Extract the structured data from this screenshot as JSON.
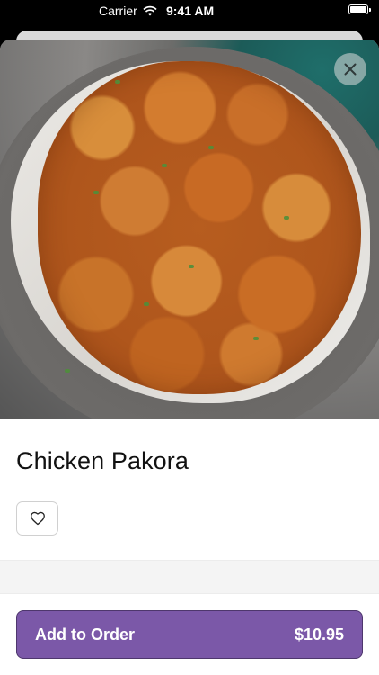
{
  "status_bar": {
    "carrier": "Carrier",
    "time": "9:41 AM"
  },
  "item": {
    "name": "Chicken Pakora",
    "image_icon": "chicken-pakora-photo"
  },
  "actions": {
    "close_icon": "close-icon",
    "favorite_icon": "heart-icon",
    "add_to_order_label": "Add to Order",
    "price": "$10.95"
  },
  "colors": {
    "accent": "#7b58a8",
    "accent_border": "#4e376d",
    "text": "#111111"
  }
}
